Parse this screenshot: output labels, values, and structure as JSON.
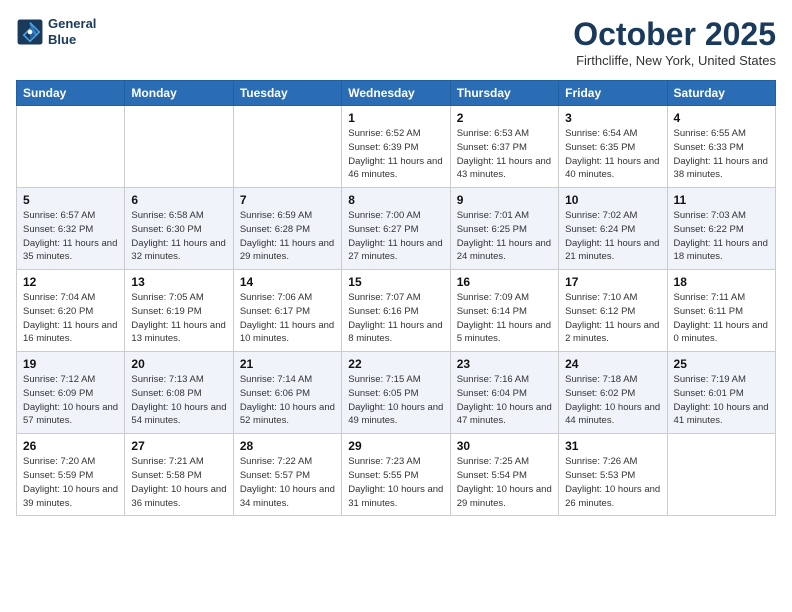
{
  "header": {
    "logo_line1": "General",
    "logo_line2": "Blue",
    "month_title": "October 2025",
    "location": "Firthcliffe, New York, United States"
  },
  "weekdays": [
    "Sunday",
    "Monday",
    "Tuesday",
    "Wednesday",
    "Thursday",
    "Friday",
    "Saturday"
  ],
  "weeks": [
    [
      {
        "day": "",
        "info": ""
      },
      {
        "day": "",
        "info": ""
      },
      {
        "day": "",
        "info": ""
      },
      {
        "day": "1",
        "info": "Sunrise: 6:52 AM\nSunset: 6:39 PM\nDaylight: 11 hours and 46 minutes."
      },
      {
        "day": "2",
        "info": "Sunrise: 6:53 AM\nSunset: 6:37 PM\nDaylight: 11 hours and 43 minutes."
      },
      {
        "day": "3",
        "info": "Sunrise: 6:54 AM\nSunset: 6:35 PM\nDaylight: 11 hours and 40 minutes."
      },
      {
        "day": "4",
        "info": "Sunrise: 6:55 AM\nSunset: 6:33 PM\nDaylight: 11 hours and 38 minutes."
      }
    ],
    [
      {
        "day": "5",
        "info": "Sunrise: 6:57 AM\nSunset: 6:32 PM\nDaylight: 11 hours and 35 minutes."
      },
      {
        "day": "6",
        "info": "Sunrise: 6:58 AM\nSunset: 6:30 PM\nDaylight: 11 hours and 32 minutes."
      },
      {
        "day": "7",
        "info": "Sunrise: 6:59 AM\nSunset: 6:28 PM\nDaylight: 11 hours and 29 minutes."
      },
      {
        "day": "8",
        "info": "Sunrise: 7:00 AM\nSunset: 6:27 PM\nDaylight: 11 hours and 27 minutes."
      },
      {
        "day": "9",
        "info": "Sunrise: 7:01 AM\nSunset: 6:25 PM\nDaylight: 11 hours and 24 minutes."
      },
      {
        "day": "10",
        "info": "Sunrise: 7:02 AM\nSunset: 6:24 PM\nDaylight: 11 hours and 21 minutes."
      },
      {
        "day": "11",
        "info": "Sunrise: 7:03 AM\nSunset: 6:22 PM\nDaylight: 11 hours and 18 minutes."
      }
    ],
    [
      {
        "day": "12",
        "info": "Sunrise: 7:04 AM\nSunset: 6:20 PM\nDaylight: 11 hours and 16 minutes."
      },
      {
        "day": "13",
        "info": "Sunrise: 7:05 AM\nSunset: 6:19 PM\nDaylight: 11 hours and 13 minutes."
      },
      {
        "day": "14",
        "info": "Sunrise: 7:06 AM\nSunset: 6:17 PM\nDaylight: 11 hours and 10 minutes."
      },
      {
        "day": "15",
        "info": "Sunrise: 7:07 AM\nSunset: 6:16 PM\nDaylight: 11 hours and 8 minutes."
      },
      {
        "day": "16",
        "info": "Sunrise: 7:09 AM\nSunset: 6:14 PM\nDaylight: 11 hours and 5 minutes."
      },
      {
        "day": "17",
        "info": "Sunrise: 7:10 AM\nSunset: 6:12 PM\nDaylight: 11 hours and 2 minutes."
      },
      {
        "day": "18",
        "info": "Sunrise: 7:11 AM\nSunset: 6:11 PM\nDaylight: 11 hours and 0 minutes."
      }
    ],
    [
      {
        "day": "19",
        "info": "Sunrise: 7:12 AM\nSunset: 6:09 PM\nDaylight: 10 hours and 57 minutes."
      },
      {
        "day": "20",
        "info": "Sunrise: 7:13 AM\nSunset: 6:08 PM\nDaylight: 10 hours and 54 minutes."
      },
      {
        "day": "21",
        "info": "Sunrise: 7:14 AM\nSunset: 6:06 PM\nDaylight: 10 hours and 52 minutes."
      },
      {
        "day": "22",
        "info": "Sunrise: 7:15 AM\nSunset: 6:05 PM\nDaylight: 10 hours and 49 minutes."
      },
      {
        "day": "23",
        "info": "Sunrise: 7:16 AM\nSunset: 6:04 PM\nDaylight: 10 hours and 47 minutes."
      },
      {
        "day": "24",
        "info": "Sunrise: 7:18 AM\nSunset: 6:02 PM\nDaylight: 10 hours and 44 minutes."
      },
      {
        "day": "25",
        "info": "Sunrise: 7:19 AM\nSunset: 6:01 PM\nDaylight: 10 hours and 41 minutes."
      }
    ],
    [
      {
        "day": "26",
        "info": "Sunrise: 7:20 AM\nSunset: 5:59 PM\nDaylight: 10 hours and 39 minutes."
      },
      {
        "day": "27",
        "info": "Sunrise: 7:21 AM\nSunset: 5:58 PM\nDaylight: 10 hours and 36 minutes."
      },
      {
        "day": "28",
        "info": "Sunrise: 7:22 AM\nSunset: 5:57 PM\nDaylight: 10 hours and 34 minutes."
      },
      {
        "day": "29",
        "info": "Sunrise: 7:23 AM\nSunset: 5:55 PM\nDaylight: 10 hours and 31 minutes."
      },
      {
        "day": "30",
        "info": "Sunrise: 7:25 AM\nSunset: 5:54 PM\nDaylight: 10 hours and 29 minutes."
      },
      {
        "day": "31",
        "info": "Sunrise: 7:26 AM\nSunset: 5:53 PM\nDaylight: 10 hours and 26 minutes."
      },
      {
        "day": "",
        "info": ""
      }
    ]
  ]
}
